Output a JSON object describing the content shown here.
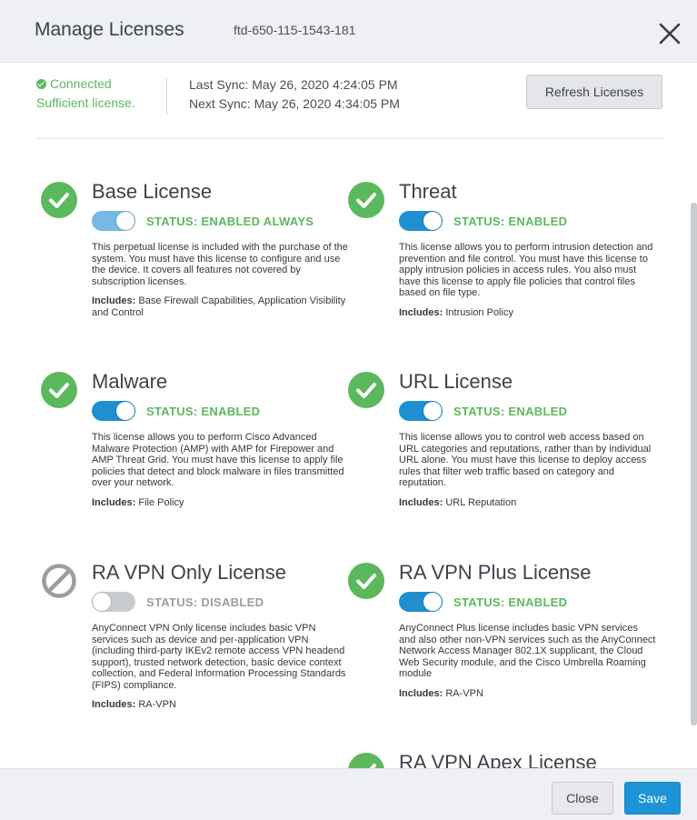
{
  "dialog": {
    "title": "Manage Licenses",
    "device_id": "ftd-650-115-1543-181",
    "close_icon": "close-x-icon"
  },
  "connection": {
    "connected": "Connected",
    "license_state": "Sufficient license.",
    "last_sync": "Last Sync: May 26, 2020 4:24:05 PM",
    "next_sync": "Next Sync: May 26, 2020 4:34:05 PM",
    "refresh_label": "Refresh Licenses"
  },
  "colors": {
    "accent_blue": "#1f8fd0",
    "enabled_green": "#5cb85c",
    "disabled_gray": "#9a9ea3"
  },
  "licenses": [
    {
      "name": "Base License",
      "icon": "check-circle-icon",
      "toggle_on": true,
      "status": "STATUS:  ENABLED ALWAYS",
      "description": "This perpetual license is included with the purchase of the system. You must have this license to configure and use the device. It covers all features not covered by subscription licenses.",
      "includes_label": "Includes:",
      "includes": "Base Firewall Capabilities, Application Visibility and Control"
    },
    {
      "name": "Threat",
      "icon": "check-circle-icon",
      "toggle_on": true,
      "status": "STATUS:  ENABLED",
      "description": "This license allows you to perform intrusion detection and prevention and file control. You must have this license to apply intrusion policies in access rules. You also must have this license to apply file policies that control files based on file type.",
      "includes_label": "Includes:",
      "includes": "Intrusion Policy"
    },
    {
      "name": "Malware",
      "icon": "check-circle-icon",
      "toggle_on": true,
      "status": "STATUS:  ENABLED",
      "description": "This license allows you to perform Cisco Advanced Malware Protection (AMP) with AMP for Firepower and AMP Threat Grid. You must have this license to apply file policies that detect and block malware in files transmitted over your network.",
      "includes_label": "Includes:",
      "includes": "File Policy"
    },
    {
      "name": "URL License",
      "icon": "check-circle-icon",
      "toggle_on": true,
      "status": "STATUS:  ENABLED",
      "description": "This license allows you to control web access based on URL categories and reputations, rather than by individual URL alone. You must have this license to deploy access rules that filter web traffic based on category and reputation.",
      "includes_label": "Includes:",
      "includes": "URL Reputation"
    },
    {
      "name": "RA VPN Only License",
      "icon": "disabled-circle-icon",
      "toggle_on": false,
      "status": "STATUS:  DISABLED",
      "description": "AnyConnect VPN Only license includes basic VPN services such as device and per-application VPN (including third-party IKEv2 remote access VPN headend support), trusted network detection, basic device context collection, and Federal Information Processing Standards (FIPS) compliance.",
      "includes_label": "Includes:",
      "includes": "RA-VPN"
    },
    {
      "name": "RA VPN Plus License",
      "icon": "check-circle-icon",
      "toggle_on": true,
      "status": "STATUS:  ENABLED",
      "description": "AnyConnect Plus license includes basic VPN services and also other non-VPN services such as the AnyConnect Network Access Manager 802.1X supplicant, the Cloud Web Security module, and the Cisco Umbrella Roaming module",
      "includes_label": "Includes:",
      "includes": "RA-VPN"
    },
    {
      "name": "RA VPN Apex License",
      "icon": "check-circle-icon"
    }
  ],
  "footer": {
    "close_label": "Close",
    "save_label": "Save"
  }
}
